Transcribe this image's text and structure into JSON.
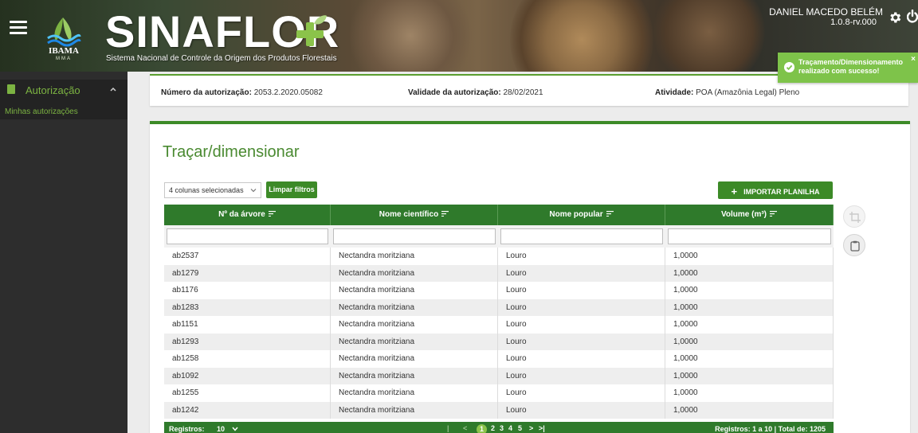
{
  "header": {
    "brand": "SINAFLOR",
    "logo_text": "IBAMA",
    "logo_subtext": "MMA",
    "tagline": "Sistema Nacional de Controle da Origem dos Produtos Florestais",
    "user_name": "DANIEL MACEDO BELÉM",
    "version": "1.0.8-rv.000",
    "menu_icon": "hamburger-icon",
    "settings_icon": "gear-icon",
    "logout_icon": "power-icon"
  },
  "toast": {
    "line1": "Traçamento/Dimensionamento",
    "line2": "realizado com sucesso!",
    "close": "×",
    "color": "#7ec34a"
  },
  "sidebar": {
    "section_label": "Autorização",
    "section_caret": "^",
    "items": [
      {
        "label": "Minhas autorizações"
      }
    ]
  },
  "info": {
    "numero_label": "Número da autorização:",
    "numero_value": "2053.2.2020.05082",
    "validade_label": "Validade da autorização:",
    "validade_value": "28/02/2021",
    "atividade_label": "Atividade:",
    "atividade_value": "POA (Amazônia Legal) Pleno"
  },
  "main": {
    "title": "Traçar/dimensionar",
    "column_select": "4 colunas selecionadas",
    "clear_filters": "Limpar filtros",
    "import_plus": "+",
    "import_label": "IMPORTAR PLANILHA",
    "accent_color": "#3c8a27"
  },
  "table": {
    "columns": [
      "Nº da árvore",
      "Nome científico",
      "Nome popular",
      "Volume (m³)"
    ],
    "rows": [
      [
        "ab2537",
        "Nectandra moritziana",
        "Louro",
        "1,0000"
      ],
      [
        "ab1279",
        "Nectandra moritziana",
        "Louro",
        "1,0000"
      ],
      [
        "ab1176",
        "Nectandra moritziana",
        "Louro",
        "1,0000"
      ],
      [
        "ab1283",
        "Nectandra moritziana",
        "Louro",
        "1,0000"
      ],
      [
        "ab1151",
        "Nectandra moritziana",
        "Louro",
        "1,0000"
      ],
      [
        "ab1293",
        "Nectandra moritziana",
        "Louro",
        "1,0000"
      ],
      [
        "ab1258",
        "Nectandra moritziana",
        "Louro",
        "1,0000"
      ],
      [
        "ab1092",
        "Nectandra moritziana",
        "Louro",
        "1,0000"
      ],
      [
        "ab1255",
        "Nectandra moritziana",
        "Louro",
        "1,0000"
      ],
      [
        "ab1242",
        "Nectandra moritziana",
        "Louro",
        "1,0000"
      ]
    ]
  },
  "footer": {
    "records_label": "Registros:",
    "page_size": "10",
    "first": "|<",
    "prev": "<",
    "pages": [
      "1",
      "2",
      "3",
      "4",
      "5"
    ],
    "next": ">",
    "last": ">|",
    "total": "Registros: 1 a 10 | Total de: 1205"
  }
}
